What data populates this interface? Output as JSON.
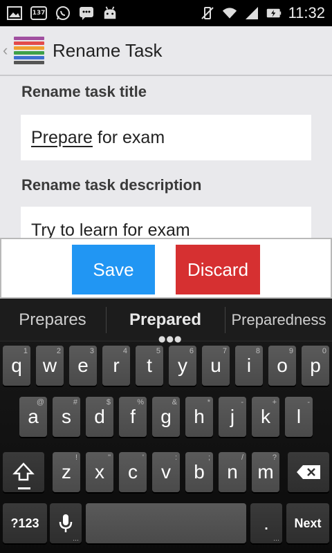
{
  "status_bar": {
    "time": "11:32",
    "badge_count": "137"
  },
  "action_bar": {
    "title": "Rename Task"
  },
  "form": {
    "title_label": "Rename task title",
    "title_value_underlined": "Prepare",
    "title_value_rest": " for exam",
    "description_label": "Rename task description",
    "description_value": "Try to learn for exam"
  },
  "buttons": {
    "save_label": "Save",
    "discard_label": "Discard",
    "save_color": "#2196f3",
    "discard_color": "#d63031"
  },
  "keyboard": {
    "suggestions": [
      "Prepares",
      "Prepared",
      "Preparedness"
    ],
    "row1": [
      {
        "k": "q",
        "h": "1"
      },
      {
        "k": "w",
        "h": "2"
      },
      {
        "k": "e",
        "h": "3"
      },
      {
        "k": "r",
        "h": "4"
      },
      {
        "k": "t",
        "h": "5"
      },
      {
        "k": "y",
        "h": "6"
      },
      {
        "k": "u",
        "h": "7"
      },
      {
        "k": "i",
        "h": "8"
      },
      {
        "k": "o",
        "h": "9"
      },
      {
        "k": "p",
        "h": "0"
      }
    ],
    "row2": [
      {
        "k": "a",
        "h": "@"
      },
      {
        "k": "s",
        "h": "#"
      },
      {
        "k": "d",
        "h": "$"
      },
      {
        "k": "f",
        "h": "%"
      },
      {
        "k": "g",
        "h": "&"
      },
      {
        "k": "h",
        "h": "*"
      },
      {
        "k": "j",
        "h": "-"
      },
      {
        "k": "k",
        "h": "+"
      },
      {
        "k": "l",
        "h": "-"
      }
    ],
    "row3": [
      {
        "k": "z",
        "h": "!"
      },
      {
        "k": "x",
        "h": "\""
      },
      {
        "k": "c",
        "h": "'"
      },
      {
        "k": "v",
        "h": ":"
      },
      {
        "k": "b",
        "h": ";"
      },
      {
        "k": "n",
        "h": "/"
      },
      {
        "k": "m",
        "h": "?"
      }
    ],
    "symbols_label": "?123",
    "period_label": ".",
    "next_label": "Next"
  }
}
